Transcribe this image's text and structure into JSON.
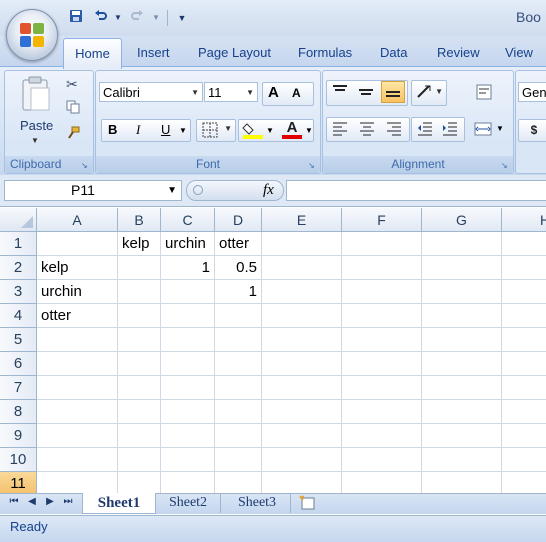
{
  "app": {
    "title": "Boo"
  },
  "quick_access": {
    "save_icon": "save-icon",
    "undo_icon": "undo-icon",
    "redo_icon": "redo-icon",
    "customize_icon": "customize-icon"
  },
  "tabs": [
    {
      "label": "Home",
      "active": true
    },
    {
      "label": "Insert"
    },
    {
      "label": "Page Layout"
    },
    {
      "label": "Formulas"
    },
    {
      "label": "Data"
    },
    {
      "label": "Review"
    },
    {
      "label": "View"
    }
  ],
  "ribbon": {
    "clipboard": {
      "label": "Clipboard",
      "paste_label": "Paste"
    },
    "font": {
      "label": "Font",
      "font_name": "Calibri",
      "font_size": "11",
      "bold": "B",
      "italic": "I",
      "underline": "U",
      "grow": "A",
      "shrink": "A",
      "font_color_letter": "A",
      "fill_color": "#ffff00",
      "font_color": "#e00000"
    },
    "alignment": {
      "label": "Alignment"
    },
    "number": {
      "format": "Gen",
      "currency": "$"
    }
  },
  "formula_bar": {
    "name_box": "P11",
    "fx_label": "fx",
    "content": ""
  },
  "grid": {
    "columns": [
      "A",
      "B",
      "C",
      "D",
      "E",
      "F",
      "G",
      "H"
    ],
    "rows": [
      "1",
      "2",
      "3",
      "4",
      "5",
      "6",
      "7",
      "8",
      "9",
      "10",
      "11"
    ],
    "cells": {
      "B1": "kelp",
      "C1": "urchin",
      "D1": "otter",
      "A2": "kelp",
      "C2": "1",
      "D2": "0.5",
      "A3": "urchin",
      "D3": "1",
      "A4": "otter"
    },
    "active_row": "11"
  },
  "sheets": [
    {
      "label": "Sheet1",
      "active": true
    },
    {
      "label": "Sheet2"
    },
    {
      "label": "Sheet3"
    }
  ],
  "status": {
    "text": "Ready"
  }
}
